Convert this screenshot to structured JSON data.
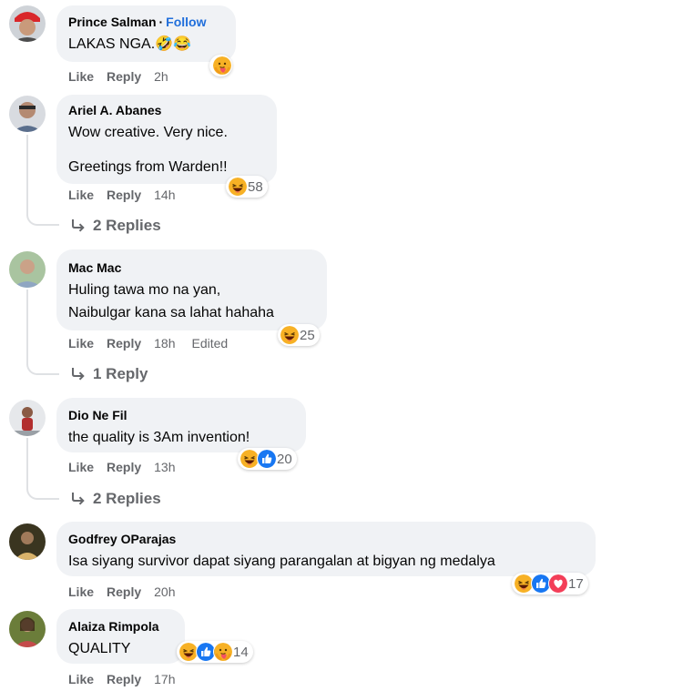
{
  "comments": [
    {
      "name": "Prince Salman",
      "follow": "Follow",
      "dot": "·",
      "lines": [
        "LAKAS NGA.🤣😂"
      ],
      "like": "Like",
      "reply": "Reply",
      "time": "2h"
    },
    {
      "name": "Ariel A. Abanes",
      "lines": [
        "Wow creative. Very nice.",
        "Greetings from Warden!!"
      ],
      "like": "Like",
      "reply": "Reply",
      "time": "14h",
      "count": "58",
      "replies": "2 Replies"
    },
    {
      "name": "Mac Mac",
      "lines": [
        "Huling tawa mo na yan,",
        "Naibulgar kana sa lahat hahaha"
      ],
      "like": "Like",
      "reply": "Reply",
      "time": "18h",
      "edited": "Edited",
      "count": "25",
      "replies": "1 Reply"
    },
    {
      "name": "Dio Ne Fil",
      "lines": [
        "the quality is 3Am invention!"
      ],
      "like": "Like",
      "reply": "Reply",
      "time": "13h",
      "count": "20",
      "replies": "2 Replies"
    },
    {
      "name": "Godfrey OParajas",
      "lines": [
        "Isa siyang survivor dapat siyang parangalan at bigyan ng medalya"
      ],
      "like": "Like",
      "reply": "Reply",
      "time": "20h",
      "count": "17"
    },
    {
      "name": "Alaiza Rimpola",
      "lines": [
        "QUALITY"
      ],
      "like": "Like",
      "reply": "Reply",
      "time": "17h",
      "count": "14"
    }
  ],
  "reaction_icons": [
    "haha-icon",
    "like-icon",
    "love-icon",
    "care-icon"
  ],
  "colors": {
    "like": "#1877f2",
    "love": "#f33e58",
    "haha": "#f7b125",
    "link": "#216fdb",
    "muted": "#65676b",
    "bubble": "#f0f2f5"
  }
}
